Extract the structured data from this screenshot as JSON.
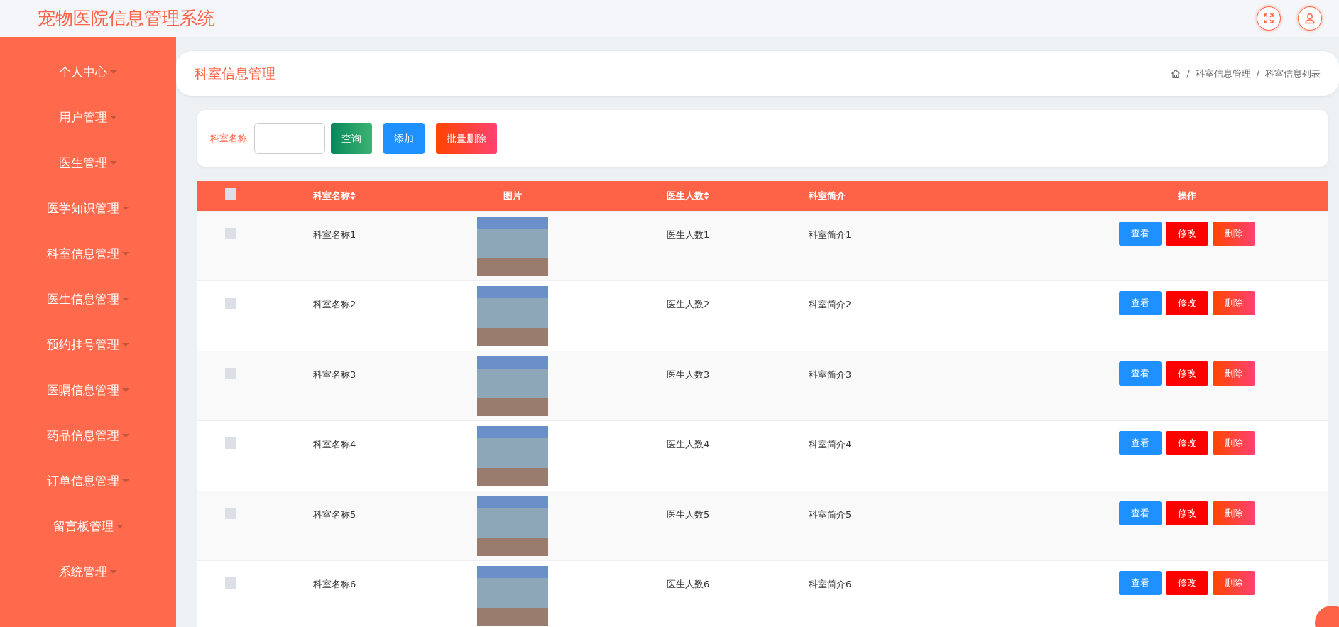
{
  "header": {
    "title": "宠物医院信息管理系统"
  },
  "sidebar": {
    "items": [
      {
        "label": "个人中心"
      },
      {
        "label": "用户管理"
      },
      {
        "label": "医生管理"
      },
      {
        "label": "医学知识管理"
      },
      {
        "label": "科室信息管理"
      },
      {
        "label": "医生信息管理"
      },
      {
        "label": "预约挂号管理"
      },
      {
        "label": "医嘱信息管理"
      },
      {
        "label": "药品信息管理"
      },
      {
        "label": "订单信息管理"
      },
      {
        "label": "留言板管理"
      },
      {
        "label": "系统管理"
      }
    ]
  },
  "page_header": {
    "title": "科室信息管理",
    "breadcrumb": [
      {
        "separator": "/",
        "label": "科室信息管理"
      },
      {
        "separator": "/",
        "label": "科室信息列表"
      }
    ]
  },
  "search": {
    "label": "科室名称",
    "buttons": [
      {
        "label": "查询",
        "kind": "search"
      },
      {
        "label": "添加",
        "kind": "add"
      },
      {
        "label": "批量删除",
        "kind": "batch_delete"
      }
    ]
  },
  "table": {
    "select_all_checked": false,
    "columns": [
      {
        "label": "科室名称",
        "sortable": true
      },
      {
        "label": "图片",
        "sortable": false
      },
      {
        "label": "医生人数",
        "sortable": true
      },
      {
        "label": "科室简介",
        "sortable": false
      },
      {
        "label": "操作",
        "sortable": false
      }
    ],
    "rows": [
      {
        "checked": false,
        "name": "科室名称1",
        "count": "医生人数1",
        "intro": "科室简介1",
        "actions": [
          {
            "label": "查看",
            "kind": "view"
          },
          {
            "label": "修改",
            "kind": "edit"
          },
          {
            "label": "删除",
            "kind": "delete"
          }
        ]
      },
      {
        "checked": false,
        "name": "科室名称2",
        "count": "医生人数2",
        "intro": "科室简介2",
        "actions": [
          {
            "label": "查看",
            "kind": "view"
          },
          {
            "label": "修改",
            "kind": "edit"
          },
          {
            "label": "删除",
            "kind": "delete"
          }
        ]
      },
      {
        "checked": false,
        "name": "科室名称3",
        "count": "医生人数3",
        "intro": "科室简介3",
        "actions": [
          {
            "label": "查看",
            "kind": "view"
          },
          {
            "label": "修改",
            "kind": "edit"
          },
          {
            "label": "删除",
            "kind": "delete"
          }
        ]
      },
      {
        "checked": false,
        "name": "科室名称4",
        "count": "医生人数4",
        "intro": "科室简介4",
        "actions": [
          {
            "label": "查看",
            "kind": "view"
          },
          {
            "label": "修改",
            "kind": "edit"
          },
          {
            "label": "删除",
            "kind": "delete"
          }
        ]
      },
      {
        "checked": false,
        "name": "科室名称5",
        "count": "医生人数5",
        "intro": "科室简介5",
        "actions": [
          {
            "label": "查看",
            "kind": "view"
          },
          {
            "label": "修改",
            "kind": "edit"
          },
          {
            "label": "删除",
            "kind": "delete"
          }
        ]
      },
      {
        "checked": false,
        "name": "科室名称6",
        "count": "医生人数6",
        "intro": "科室简介6",
        "actions": [
          {
            "label": "查看",
            "kind": "view"
          },
          {
            "label": "修改",
            "kind": "edit"
          },
          {
            "label": "删除",
            "kind": "delete"
          }
        ]
      }
    ]
  }
}
